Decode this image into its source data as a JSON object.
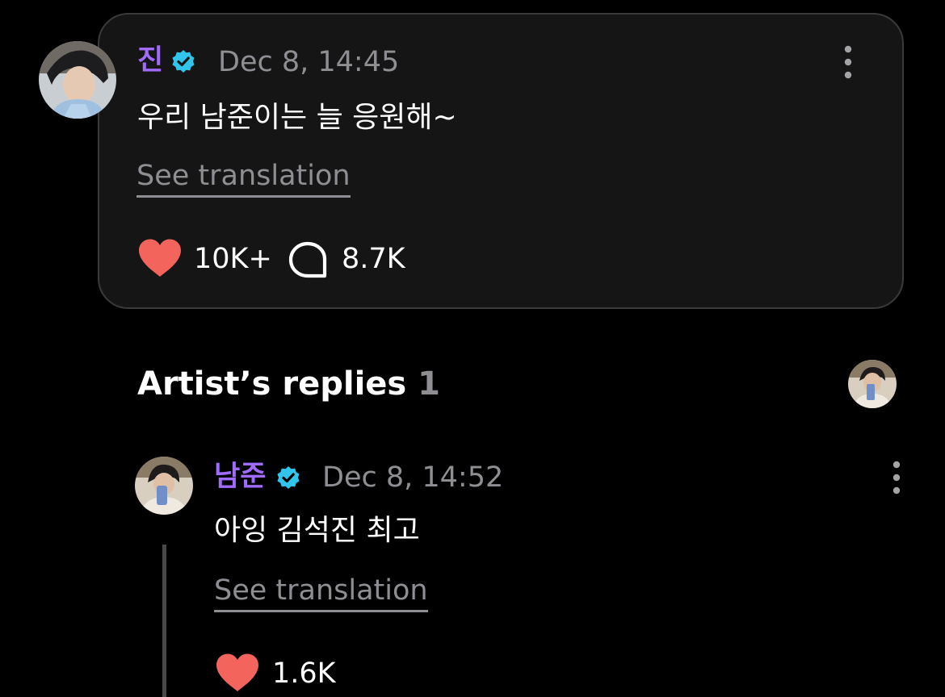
{
  "colors": {
    "name_purple": "#a16bff",
    "verified_blue": "#32c5ec",
    "muted_text": "#8e8e93",
    "heart_red": "#f2645c",
    "thread_line": "#48484a"
  },
  "post": {
    "author": "진",
    "verified_icon": "verified-badge-icon",
    "timestamp": "Dec 8, 14:45",
    "text": "우리 남준이는 늘 응원해~",
    "see_translation": "See translation",
    "likes": "10K+",
    "comments": "8.7K",
    "more_icon": "vertical-ellipsis-icon"
  },
  "artist_replies": {
    "title": "Artist’s replies",
    "count": "1"
  },
  "reply": {
    "author": "남준",
    "verified_icon": "verified-badge-icon",
    "timestamp": "Dec 8, 14:52",
    "text": "아잉 김석진 최고",
    "see_translation": "See translation",
    "likes": "1.6K",
    "more_icon": "vertical-ellipsis-icon"
  }
}
